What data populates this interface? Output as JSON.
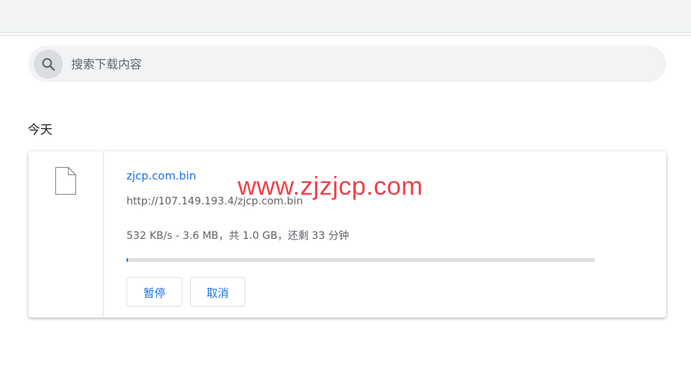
{
  "search": {
    "placeholder": "搜索下载内容",
    "icon": "search-icon"
  },
  "section": {
    "title": "今天"
  },
  "download": {
    "file_icon": "file-icon",
    "file_name": "zjcp.com.bin",
    "url": "http://107.149.193.4/zjcp.com.bin",
    "status": "532 KB/s - 3.6 MB，共 1.0 GB，还剩 33 分钟",
    "progress_fraction": 0.0035,
    "buttons": {
      "pause_label": "暂停",
      "cancel_label": "取消"
    }
  },
  "watermark": {
    "text": "www.zjzjcp.com"
  },
  "colors": {
    "accent": "#1a73e8",
    "watermark": "#f0414b",
    "background": "#ffffff",
    "surface": "#f1f3f4"
  }
}
